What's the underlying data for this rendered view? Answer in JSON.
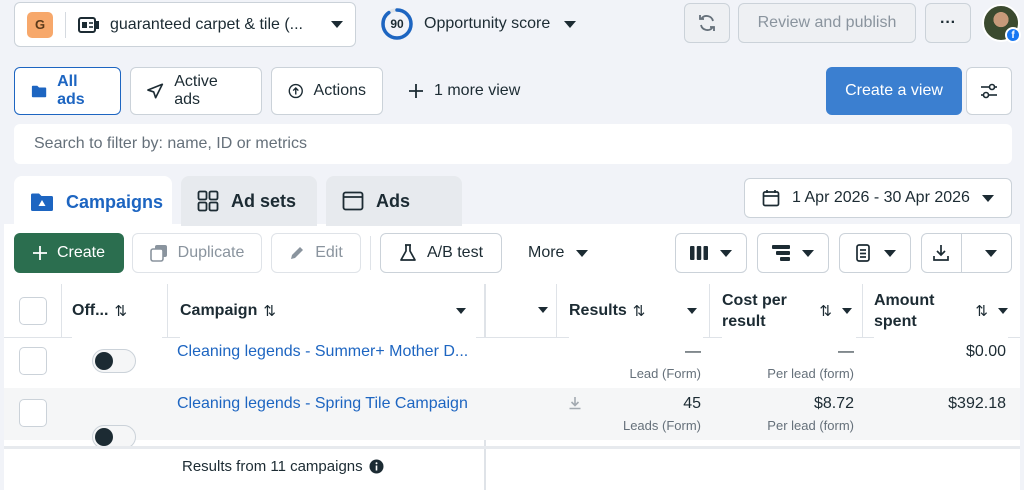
{
  "account": {
    "badge": "G",
    "name": "guaranteed carpet & tile (..."
  },
  "opportunity": {
    "score": "90",
    "label": "Opportunity score",
    "progress": 0.9
  },
  "header": {
    "review_label": "Review and publish",
    "more_label": "···"
  },
  "views": {
    "all_ads": "All ads",
    "active_ads": "Active ads",
    "actions": "Actions",
    "more_view": "1 more view",
    "create_view": "Create a view"
  },
  "search": {
    "placeholder": "Search to filter by: name, ID or metrics"
  },
  "tabs": {
    "campaigns": "Campaigns",
    "ad_sets": "Ad sets",
    "ads": "Ads"
  },
  "date_range": "1 Apr 2026 - 30 Apr 2026",
  "toolbar": {
    "create": "Create",
    "duplicate": "Duplicate",
    "edit": "Edit",
    "ab_test": "A/B test",
    "more": "More"
  },
  "table": {
    "columns": {
      "off_on": "Off...",
      "campaign": "Campaign",
      "results": "Results",
      "cost_per_result_1": "Cost per",
      "cost_per_result_2": "result",
      "amount_spent_1": "Amount",
      "amount_spent_2": "spent"
    },
    "rows": [
      {
        "name": "Cleaning legends - Summer+ Mother D...",
        "results": "—",
        "results_sub": "Lead (Form)",
        "cost": "—",
        "cost_sub": "Per lead (form)",
        "spent": "$0.00"
      },
      {
        "name": "Cleaning legends - Spring Tile Campaign",
        "results": "45",
        "results_sub": "Leads (Form)",
        "cost": "$8.72",
        "cost_sub": "Per lead (form)",
        "spent": "$392.18"
      }
    ],
    "footer": "Results from 11 campaigns"
  },
  "colors": {
    "primary": "#3b7fd0",
    "create": "#2b6e4f",
    "link": "#1d65c1",
    "facebook": "#1877f2"
  }
}
